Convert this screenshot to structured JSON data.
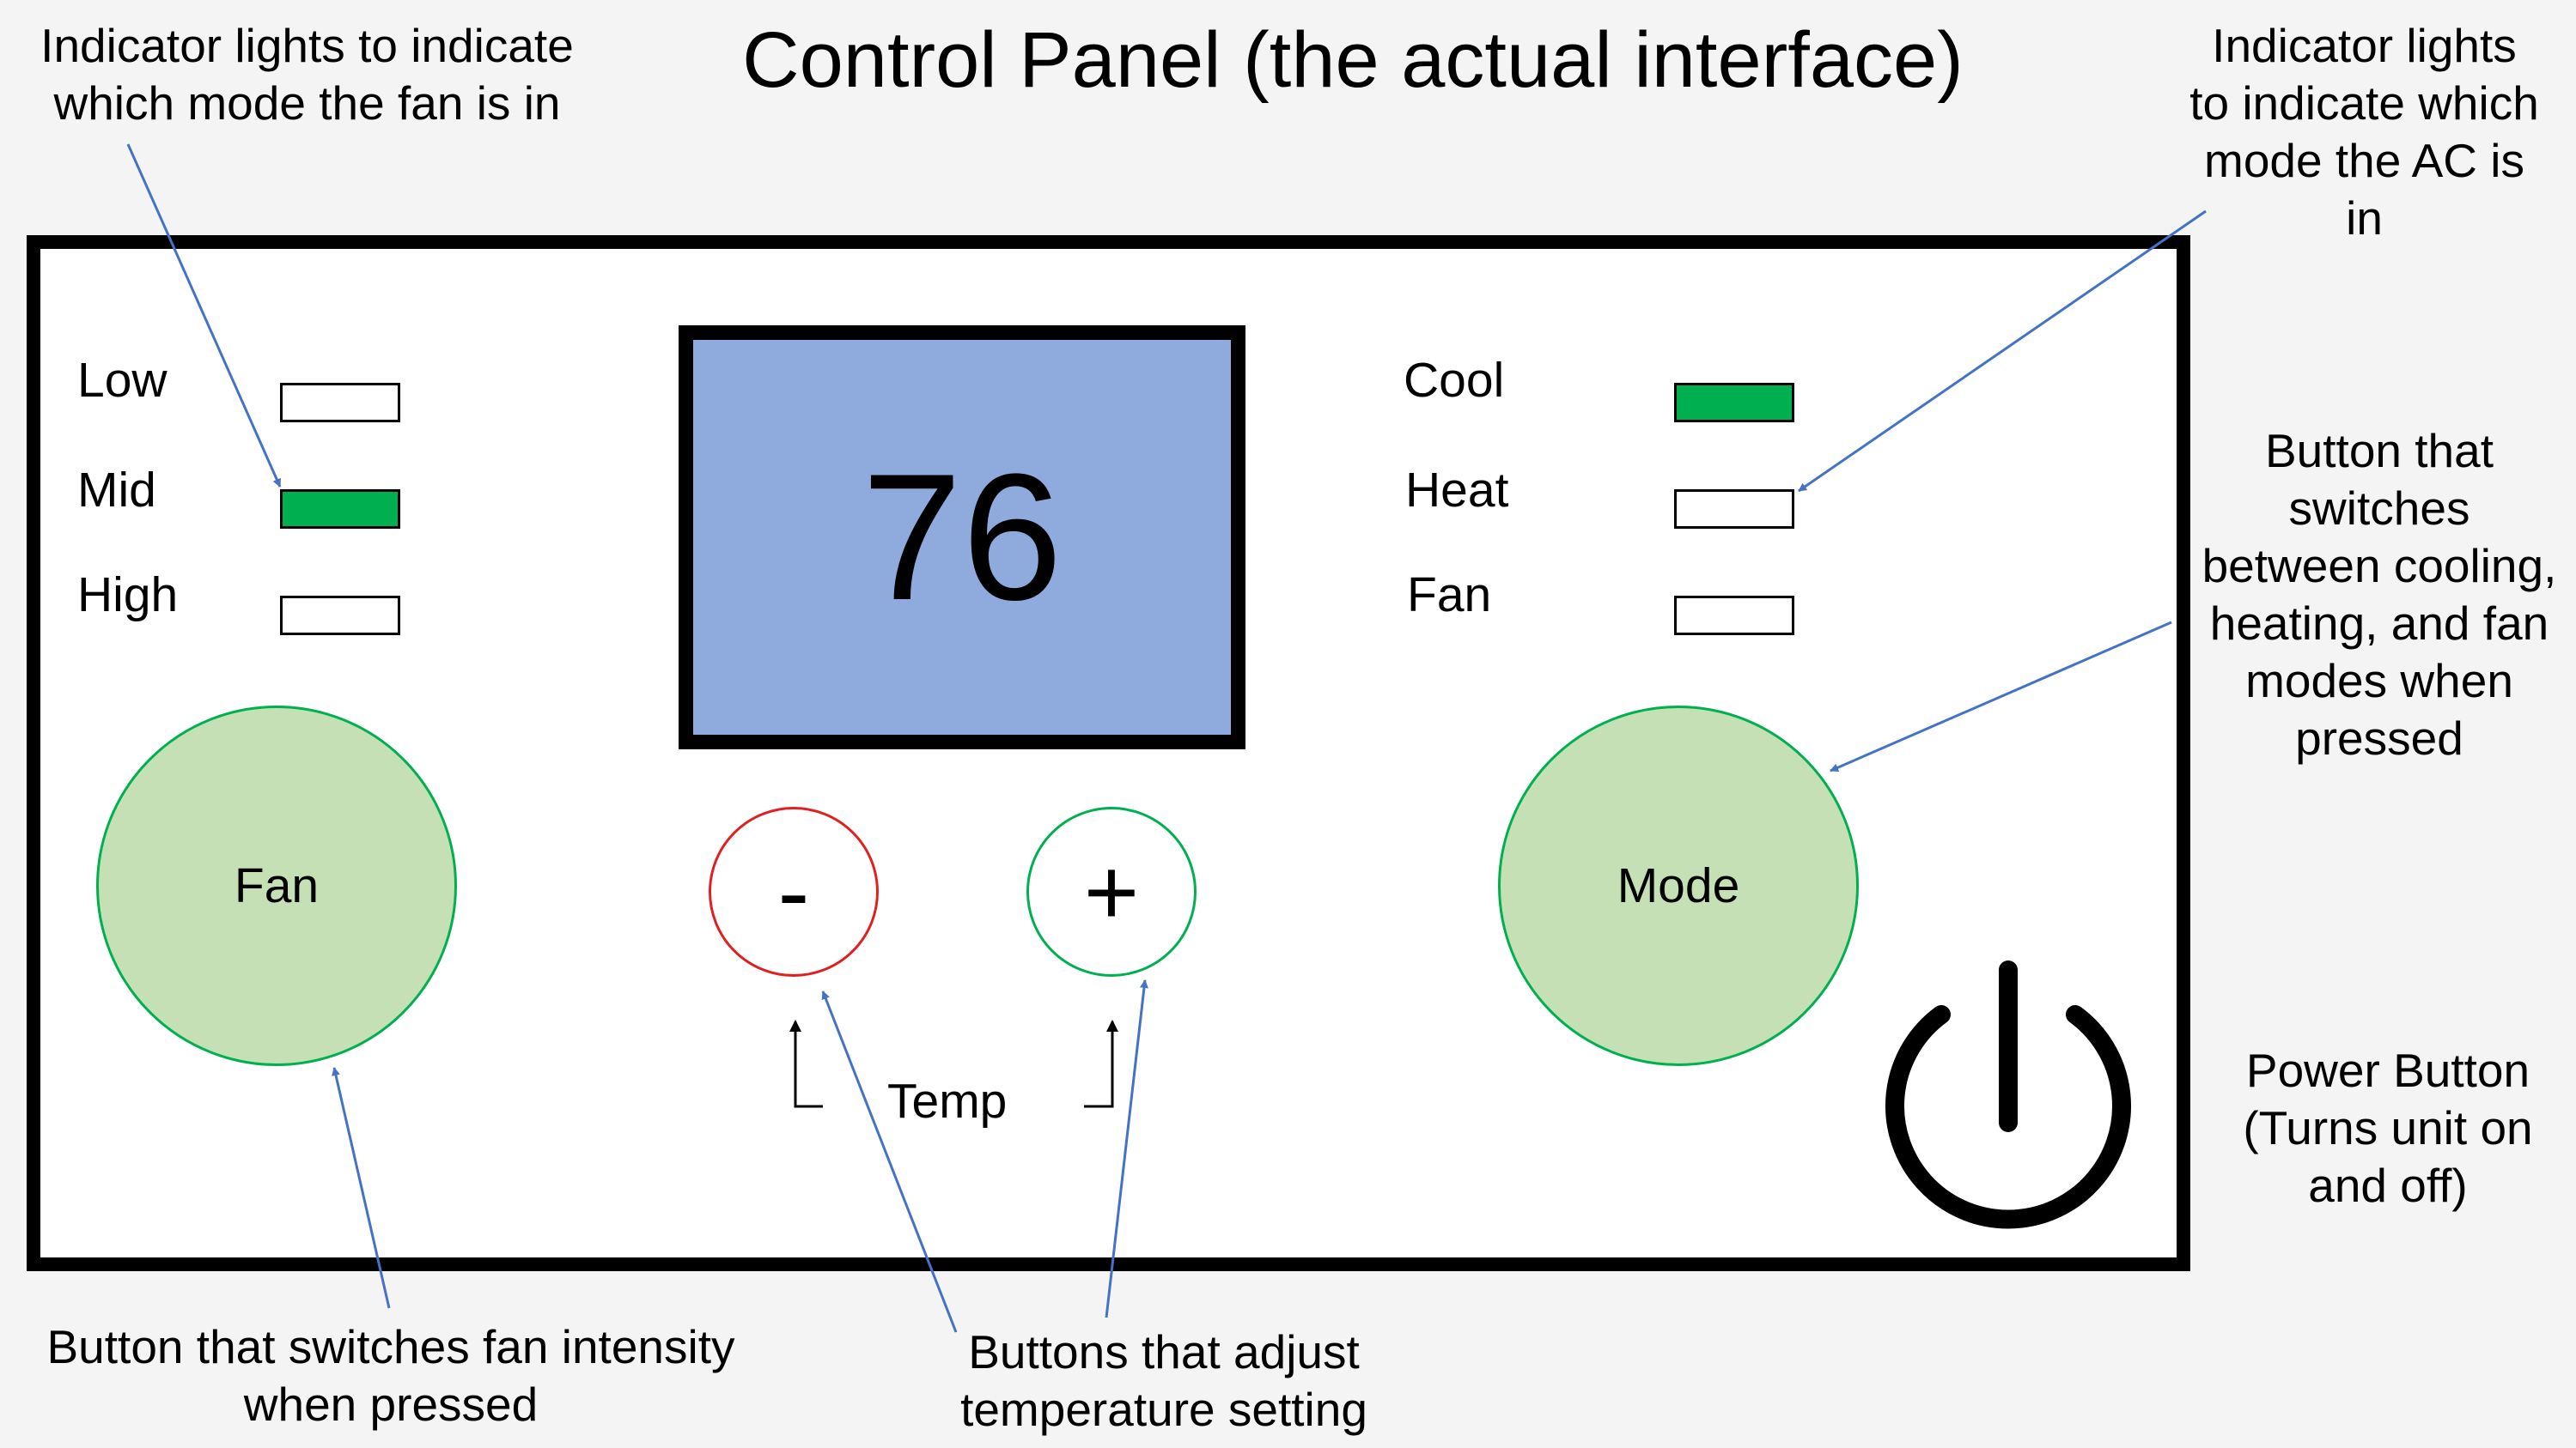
{
  "title": "Control Panel (the actual interface)",
  "annotations": {
    "fan_lights": [
      "Indicator lights to indicate",
      "which mode the fan is in"
    ],
    "ac_lights": [
      "Indicator lights",
      "to indicate which",
      "mode the AC is",
      "in"
    ],
    "mode_button": [
      "Button that",
      "switches",
      "between cooling,",
      "heating, and fan",
      "modes when",
      "pressed"
    ],
    "power_button": [
      "Power Button",
      "(Turns unit on",
      "and off)"
    ],
    "fan_button": [
      "Button that switches fan intensity",
      "when pressed"
    ],
    "temp_buttons": [
      "Buttons that adjust",
      "temperature setting"
    ]
  },
  "fan_modes": [
    {
      "label": "Low",
      "on": false
    },
    {
      "label": "Mid",
      "on": true
    },
    {
      "label": "High",
      "on": false
    }
  ],
  "ac_modes": [
    {
      "label": "Cool",
      "on": true
    },
    {
      "label": "Heat",
      "on": false
    },
    {
      "label": "Fan",
      "on": false
    }
  ],
  "display": {
    "temperature": "76"
  },
  "buttons": {
    "fan_label": "Fan",
    "mode_label": "Mode",
    "minus_label": "-",
    "plus_label": "+",
    "temp_label": "Temp"
  },
  "colors": {
    "indicator_on": "#00b050",
    "display_bg": "#8faadc",
    "button_bg": "#c5e0b4",
    "minus_border": "#e02020",
    "plus_border": "#00b050",
    "arrow": "#4472c4"
  },
  "icons": {
    "power": "power-icon"
  }
}
